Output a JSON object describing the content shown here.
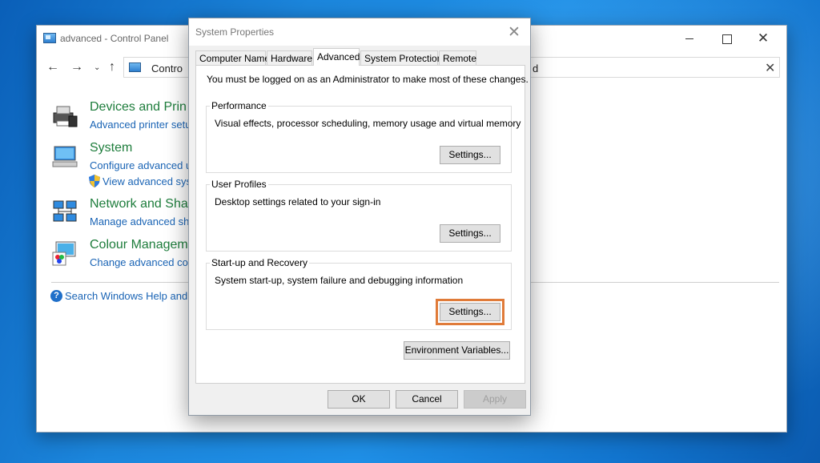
{
  "control_panel": {
    "title": "advanced - Control Panel",
    "address_visible": "Contro",
    "address_tail": "d",
    "items": [
      {
        "title": "Devices and Prin",
        "link": "Advanced printer setup",
        "icon": "printer-icon"
      },
      {
        "title": "System",
        "link": "Configure advanced us",
        "link2": "View advanced syst",
        "icon": "computer-icon"
      },
      {
        "title": "Network and Sha",
        "link": "Manage advanced sha",
        "icon": "network-icon"
      },
      {
        "title": "Colour Managem",
        "link": "Change advanced colo",
        "icon": "colour-management-icon"
      }
    ],
    "help_link": "Search Windows Help and S"
  },
  "dialog": {
    "title": "System Properties",
    "tabs": [
      {
        "label": "Computer Name",
        "active": false
      },
      {
        "label": "Hardware",
        "active": false
      },
      {
        "label": "Advanced",
        "active": true
      },
      {
        "label": "System Protection",
        "active": false
      },
      {
        "label": "Remote",
        "active": false
      }
    ],
    "admin_note": "You must be logged on as an Administrator to make most of these changes.",
    "groups": {
      "performance": {
        "label": "Performance",
        "description": "Visual effects, processor scheduling, memory usage and virtual memory",
        "button": "Settings..."
      },
      "user_profiles": {
        "label": "User Profiles",
        "description": "Desktop settings related to your sign-in",
        "button": "Settings..."
      },
      "startup_recovery": {
        "label": "Start-up and Recovery",
        "description": "System start-up, system failure and debugging information",
        "button": "Settings...",
        "highlight_color": "#e07b39"
      }
    },
    "env_button": "Environment Variables...",
    "ok": "OK",
    "cancel": "Cancel",
    "apply": "Apply"
  }
}
